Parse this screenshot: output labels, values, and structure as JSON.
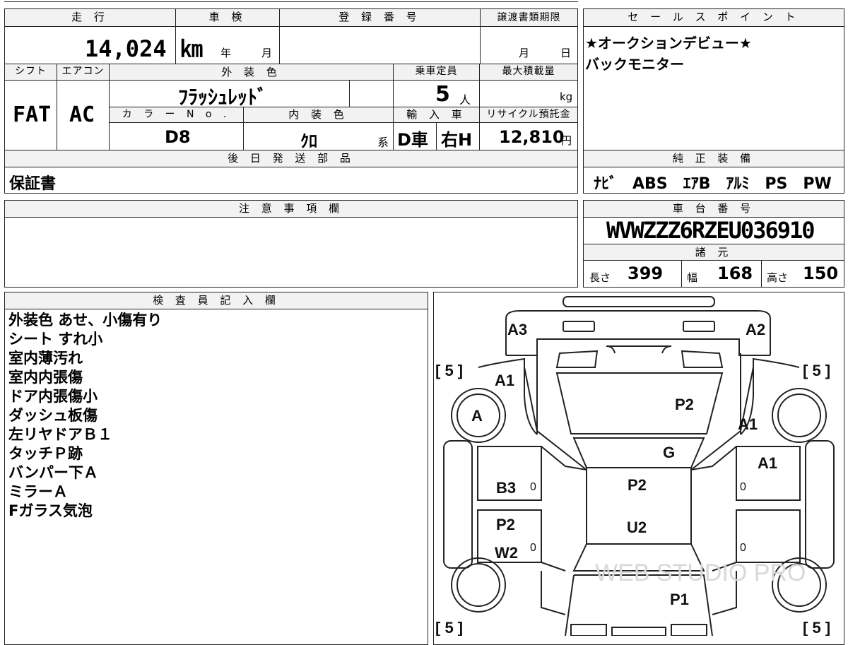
{
  "headers": {
    "mileage": "走 行",
    "inspection": "車 検",
    "registration_no": "登 録 番 号",
    "transfer_deadline": "譲渡書類期限",
    "sales_points": "セ ー ル ス ポ イ ン ト",
    "shift": "シフト",
    "aircon": "エアコン",
    "ext_color": "外 装 色",
    "capacity": "乗車定員",
    "max_load": "最大積載量",
    "color_no": "カ ラ ー N o .",
    "int_color": "内 装 色",
    "import": "輸 入 車",
    "recycle": "リサイクル預託金",
    "later_parts": "後 日 発 送 部 品",
    "genuine_equipment": "純 正 装 備",
    "notes": "注 意 事 項 欄",
    "chassis_no": "車 台 番 号",
    "specs": "諸 元",
    "inspector": "検 査 員 記 入 欄"
  },
  "values": {
    "mileage": "14,024 ㎞",
    "inspection_year": "年",
    "inspection_month": "月",
    "deadline_month": "月",
    "deadline_day": "日",
    "shift": "FAT",
    "aircon": "AC",
    "ext_color": "ﾌﾗｯｼｭﾚｯﾄﾞ",
    "capacity": "5",
    "capacity_unit": "人",
    "max_load_unit": "kg",
    "color_no": "D8",
    "int_color": "ｸﾛ",
    "int_color_suffix": "系",
    "import_type": "D車",
    "steering": "右H",
    "recycle": "12,810",
    "recycle_unit": "円",
    "later_parts": "保証書",
    "equipment": "ﾅﾋﾞ　ABS　ｴｱB　ｱﾙﾐ　PS　PW",
    "chassis_no": "WVWZZZ6RZEU036910",
    "length_label": "長さ",
    "length": "399",
    "width_label": "幅",
    "width": "168",
    "height_label": "高さ",
    "height": "150"
  },
  "sales_points": [
    "★オークションデビュー★",
    "バックモニター"
  ],
  "inspector_notes": [
    "外装色 あせ、小傷有り",
    "シート すれ小",
    "室内薄汚れ",
    "室内内張傷",
    "ドア内張傷小",
    "ダッシュ板傷",
    "左リヤドアＢ１",
    "タッチＰ跡",
    "バンパー下Ａ",
    "ミラーＡ",
    "Fガラス気泡"
  ],
  "diagram": {
    "front_left": "A3",
    "front_right": "A2",
    "tread_fl": "[ 5 ]",
    "tread_fr": "[ 5 ]",
    "tread_rl": "[ 5 ]",
    "tread_rr": "[ 5 ]",
    "fender_left": "A1",
    "wheel_fl": "A",
    "hood": "P2",
    "fender_right": "A1",
    "windshield": "G",
    "front_door_right": "A1",
    "front_door_left": "B3",
    "roof": "P2",
    "rear_door_left_1": "P2",
    "rear_door_left_2": "W2",
    "roof_rear": "U2",
    "trunk": "P1",
    "zero": "0",
    "watermark": "WEB STUDIO PRO"
  }
}
